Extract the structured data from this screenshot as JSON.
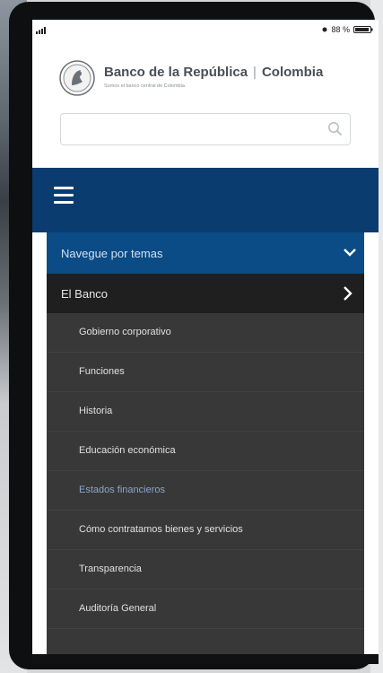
{
  "status": {
    "battery_percent_label": "88 %"
  },
  "header": {
    "brand_name": "Banco de la República",
    "brand_separator": "|",
    "brand_country": "Colombia",
    "tagline": "Somos el banco central de Colombia"
  },
  "search": {
    "placeholder": ""
  },
  "menu": {
    "topics_label": "Navegue por temas",
    "section_label": "El Banco",
    "items": [
      {
        "label": "Gobierno corporativo",
        "active": false
      },
      {
        "label": "Funciones",
        "active": false
      },
      {
        "label": "Historia",
        "active": false
      },
      {
        "label": "Educación económica",
        "active": false
      },
      {
        "label": "Estados financieros",
        "active": true
      },
      {
        "label": "Cómo contratamos bienes y servicios",
        "active": false
      },
      {
        "label": "Transparencia",
        "active": false
      },
      {
        "label": "Auditoría General",
        "active": false
      }
    ]
  },
  "colors": {
    "navbar": "#0b3c6f",
    "menu_topics": "#0b4b86",
    "menu_panel": "#383838",
    "active_item": "#8aa6c8"
  },
  "icons": [
    "signal-icon",
    "battery-icon",
    "seal-logo-icon",
    "search-icon",
    "hamburger-icon",
    "chevron-down-icon",
    "chevron-right-icon"
  ]
}
